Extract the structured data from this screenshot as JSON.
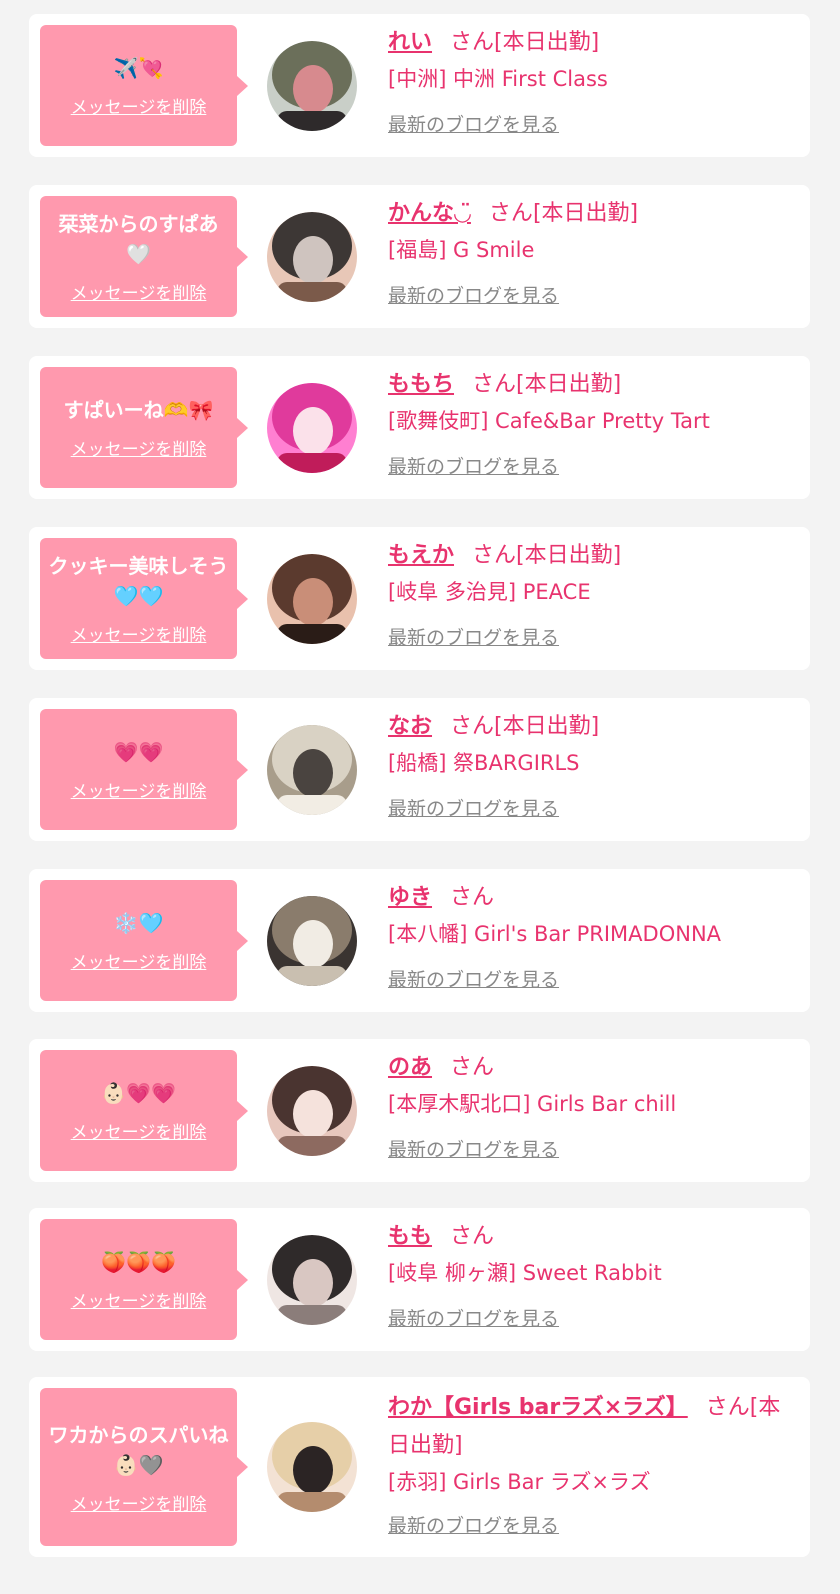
{
  "colors": {
    "background": "#f3f3f3",
    "bubble": "#ff99ae",
    "accent_pink": "#e8336e",
    "link_gray": "#888888"
  },
  "labels": {
    "delete_message": "メッセージを削除",
    "view_blog": "最新のブログを見る",
    "honorific": "さん"
  },
  "items": [
    {
      "message": "✈️💘",
      "name": "れい",
      "status": "[本日出勤]",
      "shop": "[中洲] 中洲 First Class",
      "avatar_palette": [
        "#6b6f5a",
        "#c9cfc8",
        "#2e2a2b",
        "#d78a8e"
      ]
    },
    {
      "message": "栞菜からのすぱあ🤍",
      "name": "かんな◡̈",
      "status": "[本日出勤]",
      "shop": "[福島] G Smile",
      "avatar_palette": [
        "#3d3735",
        "#e8c7b7",
        "#7b5a4a",
        "#cfc4bf"
      ]
    },
    {
      "message": "すぱいーね🫶🎀",
      "name": "ももち",
      "status": "[本日出勤]",
      "shop": "[歌舞伎町] Cafe&Bar Pretty Tart",
      "avatar_palette": [
        "#e03a9c",
        "#ff7fd1",
        "#c01c5a",
        "#fbe1ea"
      ]
    },
    {
      "message": "クッキー美味しそう🩵🩵",
      "name": "もえか",
      "status": "[本日出勤]",
      "shop": "[岐阜 多治見] PEACE",
      "avatar_palette": [
        "#5b3a2e",
        "#e9c1ad",
        "#2a1c17",
        "#c98e78"
      ]
    },
    {
      "message": "💗💗",
      "name": "なお",
      "status": "[本日出勤]",
      "shop": "[船橋] 祭BARGIRLS",
      "avatar_palette": [
        "#d9d2c4",
        "#a89d8b",
        "#f2ede4",
        "#4a4440"
      ]
    },
    {
      "message": "❄️🩵",
      "name": "ゆき",
      "status": "",
      "shop": "[本八幡] Girl's Bar PRIMADONNA",
      "avatar_palette": [
        "#8a7c6c",
        "#3a3431",
        "#c9bfb0",
        "#f1ece4"
      ]
    },
    {
      "message": "👶🏻💗💗",
      "name": "のあ",
      "status": "",
      "shop": "[本厚木駅北口] Girls Bar chill",
      "avatar_palette": [
        "#4a3430",
        "#e7c7bd",
        "#8d6a60",
        "#f5e2dc"
      ]
    },
    {
      "message": "🍑🍑🍑",
      "name": "もも",
      "status": "",
      "shop": "[岐阜 柳ヶ瀬] Sweet Rabbit",
      "avatar_palette": [
        "#2f2a2a",
        "#efe6e3",
        "#8b7d7a",
        "#d9c7c2"
      ]
    },
    {
      "message": "ワカからのスパいね👶🏻🩶",
      "name": "わか【Girls barラズ×ラズ】",
      "status": "[本日出勤]",
      "shop": "[赤羽] Girls Bar ラズ×ラズ",
      "avatar_palette": [
        "#e6cfa8",
        "#f3e2d4",
        "#b48c6e",
        "#2b2424"
      ]
    }
  ]
}
